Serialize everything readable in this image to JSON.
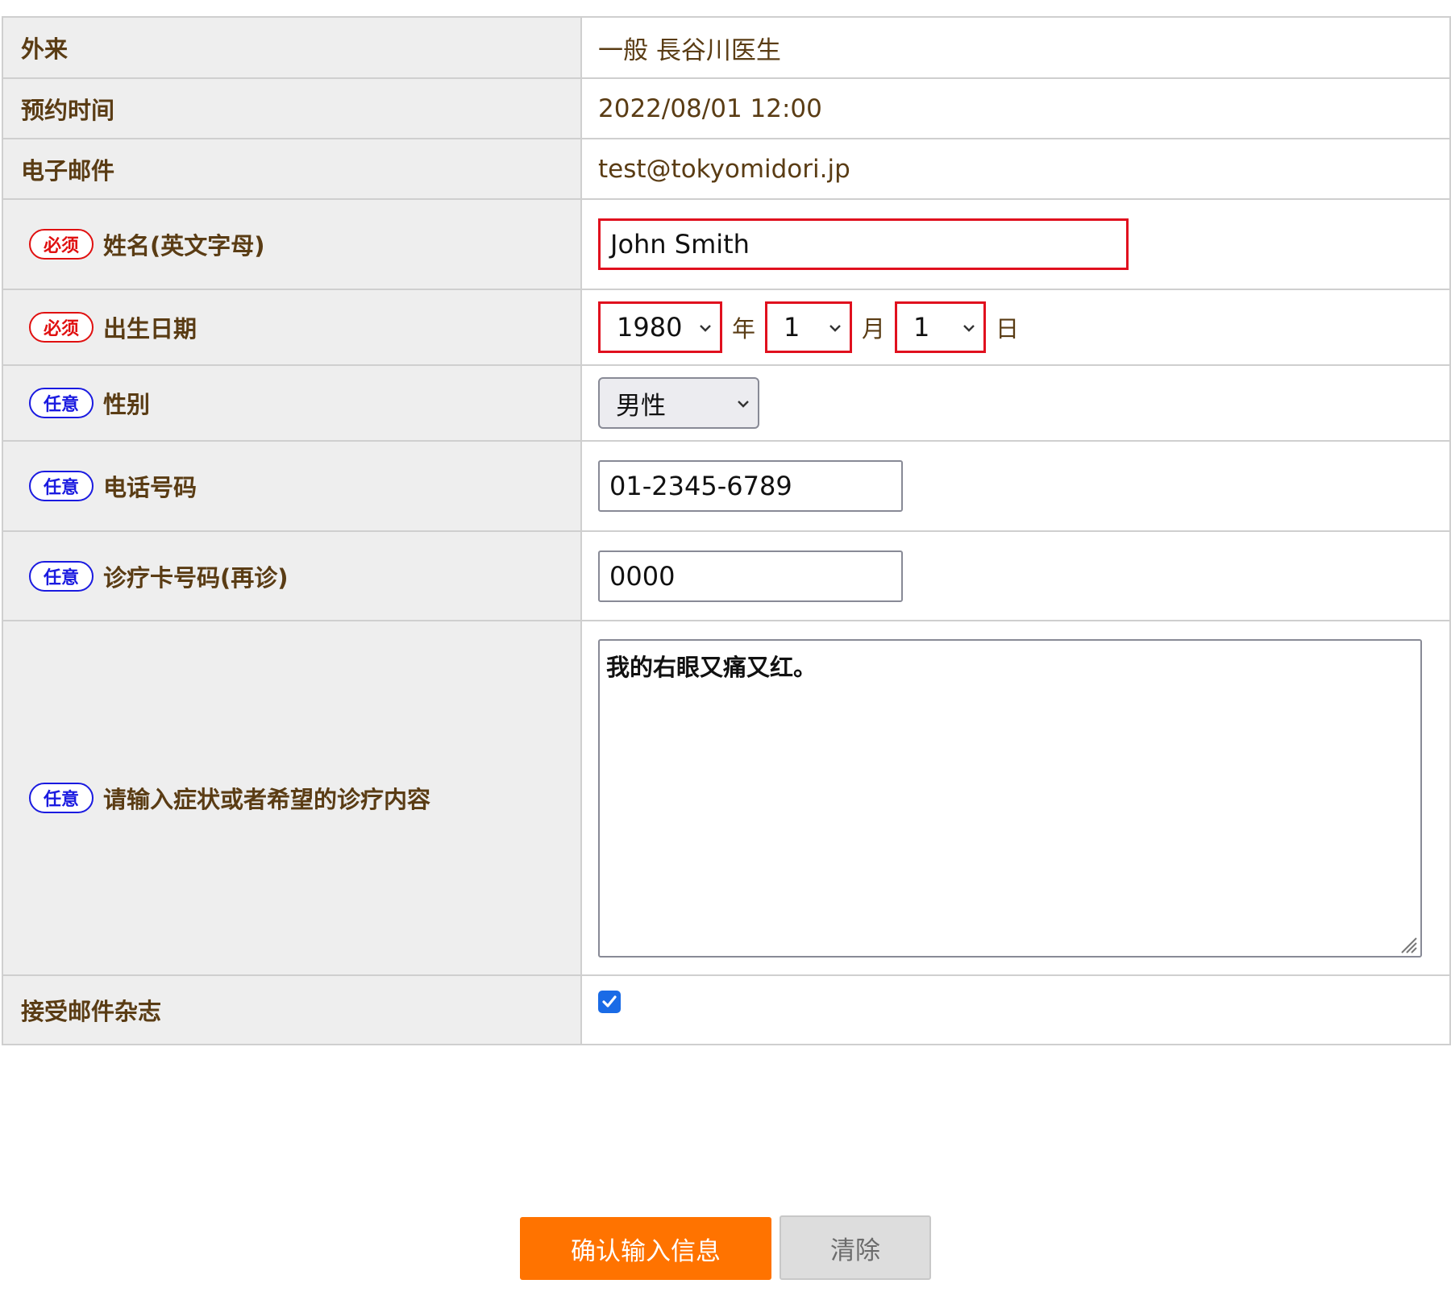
{
  "rows": {
    "outpatient": {
      "label": "外来",
      "value": "一般 長谷川医生"
    },
    "appointment": {
      "label": "预约时间",
      "value": "2022/08/01 12:00"
    },
    "email": {
      "label": "电子邮件",
      "value": "test@tokyomidori.jp"
    },
    "name": {
      "tag": "必须",
      "label": "姓名(英文字母)",
      "value": "John Smith"
    },
    "birth": {
      "tag": "必须",
      "label": "出生日期",
      "year": "1980",
      "year_unit": "年",
      "month": "1",
      "month_unit": "月",
      "day": "1",
      "day_unit": "日"
    },
    "gender": {
      "tag": "任意",
      "label": "性别",
      "value": "男性"
    },
    "phone": {
      "tag": "任意",
      "label": "电话号码",
      "value": "01-2345-6789"
    },
    "card": {
      "tag": "任意",
      "label": "诊疗卡号码(再诊)",
      "value": "0000"
    },
    "symptoms": {
      "tag": "任意",
      "label": "请输入症状或者希望的诊疗内容",
      "value": "我的右眼又痛又红。"
    },
    "newsletter": {
      "label": "接受邮件杂志",
      "checked": true
    }
  },
  "buttons": {
    "confirm": "确认输入信息",
    "clear": "清除"
  },
  "colors": {
    "label_text": "#5a3c14",
    "required": "#e01010",
    "optional": "#1a1ae0",
    "error_border": "#e0101e",
    "confirm_button": "#ff7300",
    "checkbox": "#1a6be6"
  },
  "icons": {
    "select_arrow": "chevron-down-icon",
    "checkbox": "check-icon",
    "resize": "resize-grip-icon"
  }
}
